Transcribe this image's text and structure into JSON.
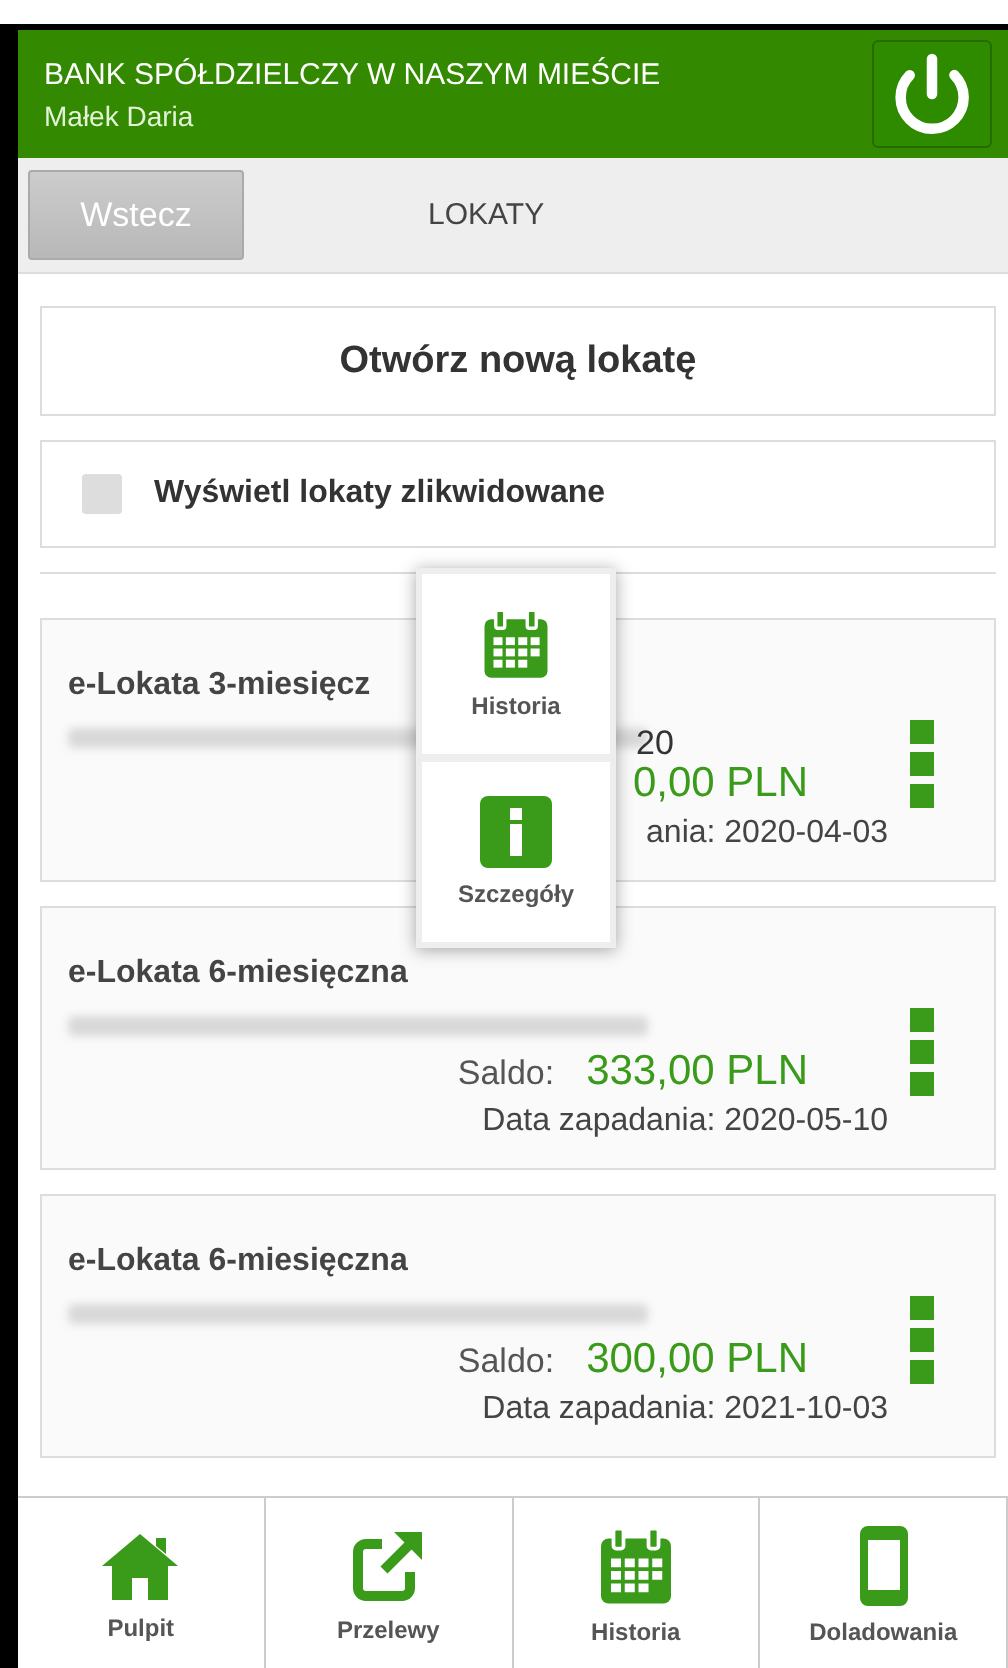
{
  "header": {
    "bank_name": "BANK SPÓŁDZIELCZY W NASZYM MIEŚCIE",
    "user_name": "Małek Daria"
  },
  "subheader": {
    "back_button": "Wstecz",
    "title": "LOKATY"
  },
  "new_deposit_button": "Otwórz nową lokatę",
  "show_closed": {
    "label": "Wyświetl lokaty zlikwidowane",
    "checked": false
  },
  "deposits": [
    {
      "name": "e-Lokata 3-miesięcz",
      "account_suffix": "20",
      "balance": "0,00 PLN",
      "maturity": "ania: 2020-04-03"
    },
    {
      "name": "e-Lokata 6-miesięczna",
      "balance_label": "Saldo:",
      "balance": "333,00 PLN",
      "maturity": "Data zapadania: 2020-05-10"
    },
    {
      "name": "e-Lokata 6-miesięczna",
      "balance_label": "Saldo:",
      "balance": "300,00 PLN",
      "maturity": "Data zapadania: 2021-10-03"
    }
  ],
  "popup_menu": [
    {
      "kind": "calendar",
      "label": "Historia"
    },
    {
      "kind": "info",
      "label": "Szczegóły"
    }
  ],
  "bottom_nav": [
    {
      "kind": "home",
      "label": "Pulpit"
    },
    {
      "kind": "transfer",
      "label": "Przelewy"
    },
    {
      "kind": "calendar",
      "label": "Historia"
    },
    {
      "kind": "phone",
      "label": "Doladowania"
    }
  ]
}
